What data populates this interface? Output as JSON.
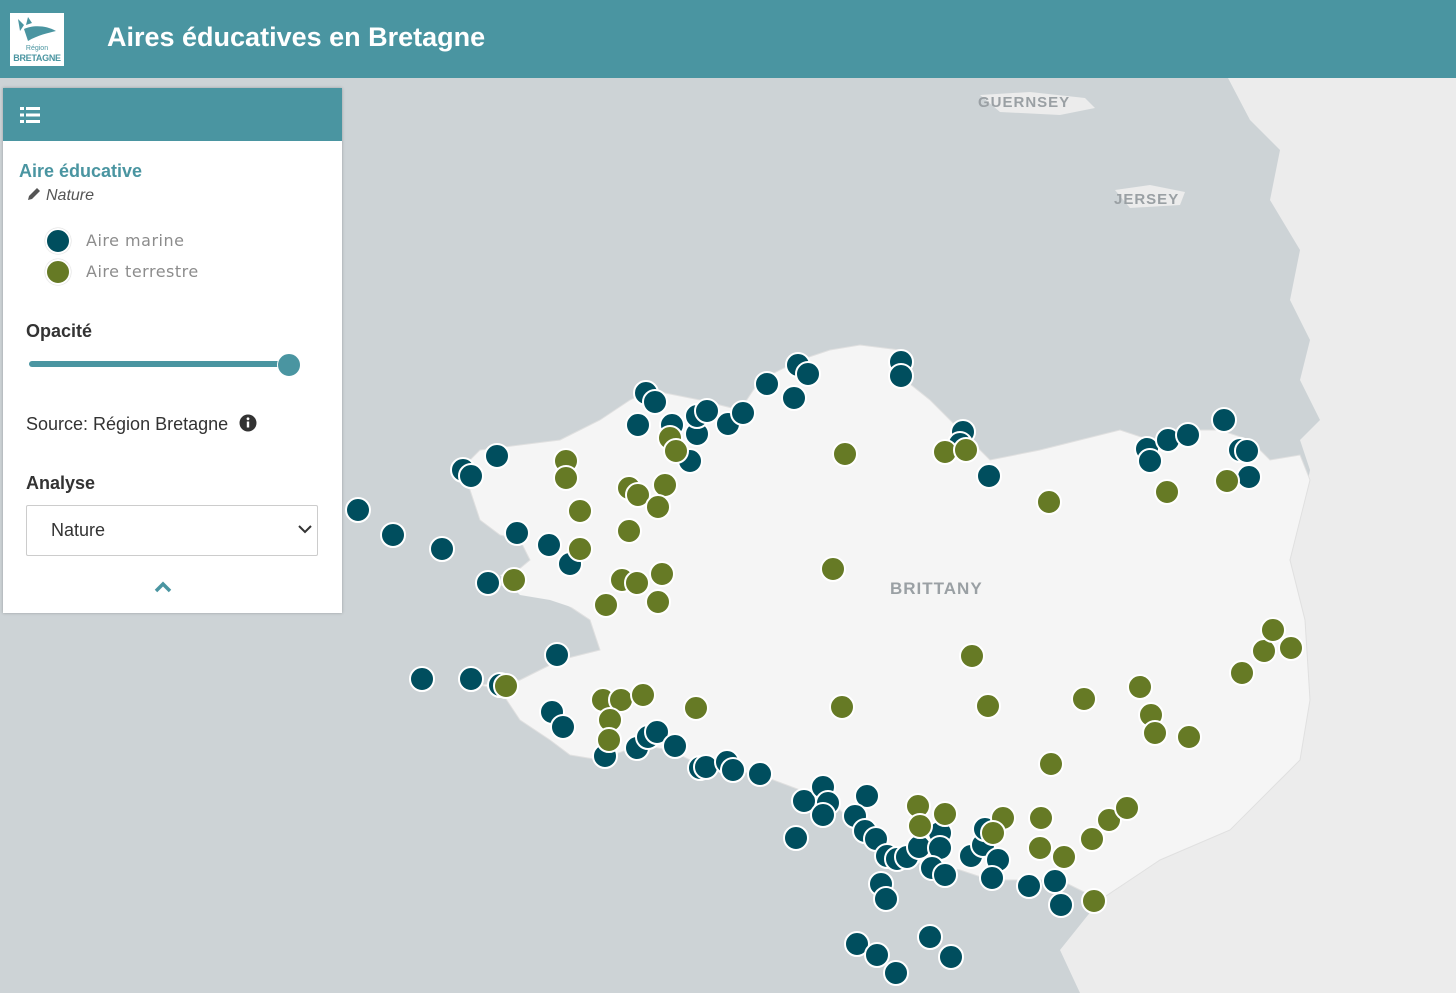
{
  "header": {
    "title": "Aires éducatives en Bretagne",
    "logo": {
      "line1": "Région",
      "line2": "BRETAGNE"
    }
  },
  "panel": {
    "layer_title": "Aire éducative",
    "theme_label": "Nature",
    "legend": [
      {
        "label": "Aire marine",
        "color": "#004e5e"
      },
      {
        "label": "Aire terrestre",
        "color": "#667a25"
      }
    ],
    "opacity_label": "Opacité",
    "opacity_value": 1.0,
    "source_text": "Source: Région Bretagne",
    "analyse_label": "Analyse",
    "analyse_selected": "Nature"
  },
  "map": {
    "labels": [
      "GUERNSEY",
      "JERSEY",
      "BRITTANY"
    ],
    "colors": {
      "marine": "#004e5e",
      "terrestre": "#667a25",
      "sea": "#cdd3d6",
      "land": "#f4f4f4"
    }
  },
  "icons": [
    "list-icon",
    "pencil-icon",
    "info-icon",
    "chevron-down-icon",
    "chevron-up-icon"
  ]
}
